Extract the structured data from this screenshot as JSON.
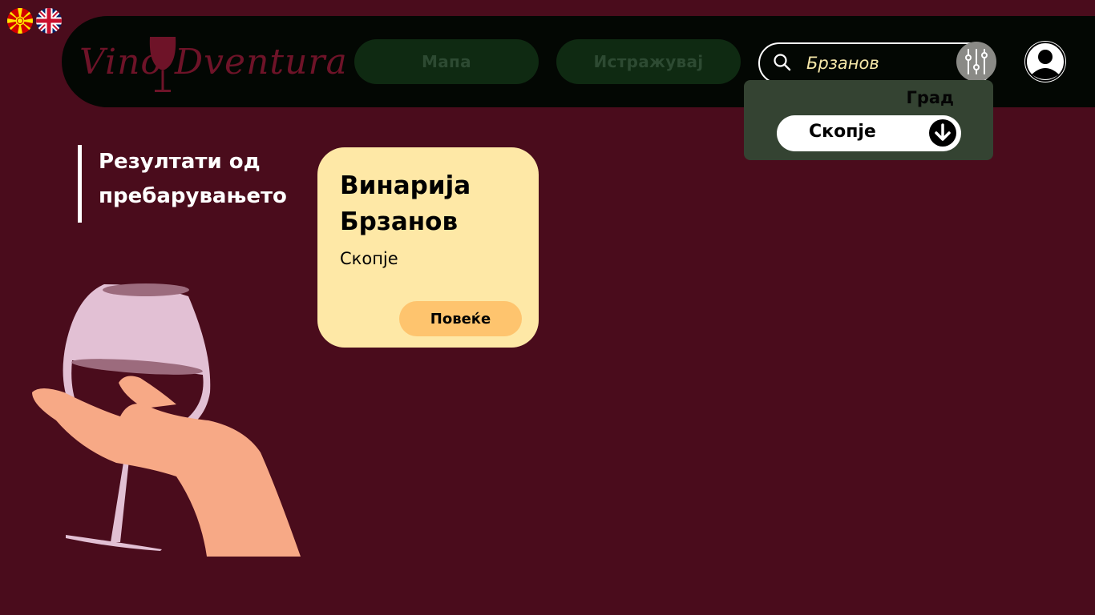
{
  "languages": [
    {
      "code": "mk",
      "label": "Macedonian"
    },
    {
      "code": "en",
      "label": "English"
    }
  ],
  "header": {
    "logo_text": "Vino Dventura",
    "nav": {
      "map_label": "Мапа",
      "explore_label": "Истражувај"
    },
    "search": {
      "value": "Брзанов"
    }
  },
  "filter": {
    "label": "Град",
    "city_value": "Скопје"
  },
  "results": {
    "heading_line1": "Резултати од",
    "heading_line2": "пребарувањето"
  },
  "cards": [
    {
      "title_line1": "Винарија",
      "title_line2": "Брзанов",
      "city": "Скопје",
      "button_label": "Повеќе"
    }
  ],
  "colors": {
    "background": "#4a0c1c",
    "header": "#030703",
    "nav_button": "#0f2a12",
    "card": "#fee8a6",
    "card_button": "#fec46e",
    "filter_panel": "#344332",
    "logo": "#6e1328"
  }
}
